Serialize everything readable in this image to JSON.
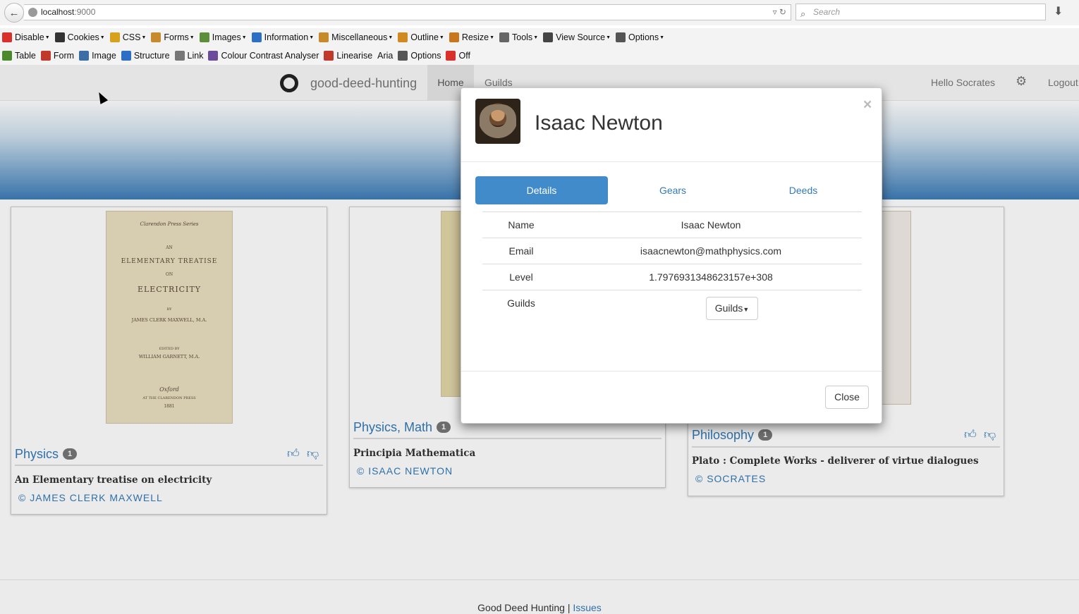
{
  "browser": {
    "url_host": "localhost",
    "url_port": ":9000",
    "search_placeholder": "Search"
  },
  "webdev_toolbar": {
    "row1": [
      {
        "label": "Disable",
        "icon": "disable-icon",
        "color": "#d9302b",
        "dropdown": true
      },
      {
        "label": "Cookies",
        "icon": "cookies-icon",
        "color": "#333333",
        "dropdown": true
      },
      {
        "label": "CSS",
        "icon": "css-icon",
        "color": "#d6a21b",
        "dropdown": true
      },
      {
        "label": "Forms",
        "icon": "forms-icon",
        "color": "#c58b2e",
        "dropdown": true
      },
      {
        "label": "Images",
        "icon": "images-icon",
        "color": "#5c8f3a",
        "dropdown": true
      },
      {
        "label": "Information",
        "icon": "information-icon",
        "color": "#2d6fc4",
        "dropdown": true
      },
      {
        "label": "Miscellaneous",
        "icon": "miscellaneous-icon",
        "color": "#c78a2b",
        "dropdown": true
      },
      {
        "label": "Outline",
        "icon": "outline-icon",
        "color": "#d18a20",
        "dropdown": true
      },
      {
        "label": "Resize",
        "icon": "resize-icon",
        "color": "#c9771f",
        "dropdown": true
      },
      {
        "label": "Tools",
        "icon": "tools-icon",
        "color": "#666666",
        "dropdown": true
      },
      {
        "label": "View Source",
        "icon": "view-source-icon",
        "color": "#444444",
        "dropdown": true
      },
      {
        "label": "Options",
        "icon": "options-icon",
        "color": "#555555",
        "dropdown": true
      }
    ],
    "row2": [
      {
        "label": "Table",
        "icon": "table-icon",
        "color": "#4a8a2a"
      },
      {
        "label": "Form",
        "icon": "form-icon",
        "color": "#c0392b"
      },
      {
        "label": "Image",
        "icon": "image-icon",
        "color": "#3a6ea5"
      },
      {
        "label": "Structure",
        "icon": "structure-icon",
        "color": "#2d6fc4"
      },
      {
        "label": "Link",
        "icon": "link-icon",
        "color": "#777777"
      },
      {
        "label": "Colour Contrast Analyser",
        "icon": "colour-contrast-icon",
        "color": "#6a4a9a"
      },
      {
        "label": "Linearise",
        "icon": "linearise-icon",
        "color": "#c0392b"
      },
      {
        "label": "Aria",
        "icon": "",
        "color": ""
      },
      {
        "label": "Options",
        "icon": "options-icon",
        "color": "#555555"
      },
      {
        "label": "Off",
        "icon": "off-icon",
        "color": "#d9302b"
      }
    ]
  },
  "navbar": {
    "brand": "good-deed-hunting",
    "home": "Home",
    "guilds": "Guilds",
    "hello": "Hello Socrates",
    "logout": "Logout"
  },
  "cards": [
    {
      "category": "Physics",
      "count": "1",
      "title": "An Elementary treatise on electricity",
      "author": "© JAMES CLERK MAXWELL",
      "cover": [
        "Clarendon Press Series",
        "AN",
        "ELEMENTARY TREATISE",
        "ON",
        "ELECTRICITY",
        "BY",
        "JAMES CLERK MAXWELL, M.A.",
        "EDITED BY",
        "WILLIAM GARNETT, M.A.",
        "Oxford",
        "AT THE CLARENDON PRESS",
        "1881"
      ]
    },
    {
      "category": "Physics, Math",
      "count": "1",
      "title": "Principia Mathematica",
      "author": "© ISAAC NEWTON"
    },
    {
      "category": "Philosophy",
      "count": "1",
      "title": "Plato : Complete Works - deliverer of virtue dialogues",
      "author": "© SOCRATES"
    }
  ],
  "footer": {
    "text": "Good Deed Hunting |",
    "link": "Issues"
  },
  "modal": {
    "title": "Isaac Newton",
    "close_x": "×",
    "tabs": [
      "Details",
      "Gears",
      "Deeds"
    ],
    "active_tab": "Details",
    "rows": [
      {
        "key": "Name",
        "value": "Isaac Newton"
      },
      {
        "key": "Email",
        "value": "isaacnewton@mathphysics.com"
      },
      {
        "key": "Level",
        "value": "1.7976931348623157e+308"
      }
    ],
    "guilds_label": "Guilds",
    "guilds_button": "Guilds",
    "close_button": "Close"
  }
}
